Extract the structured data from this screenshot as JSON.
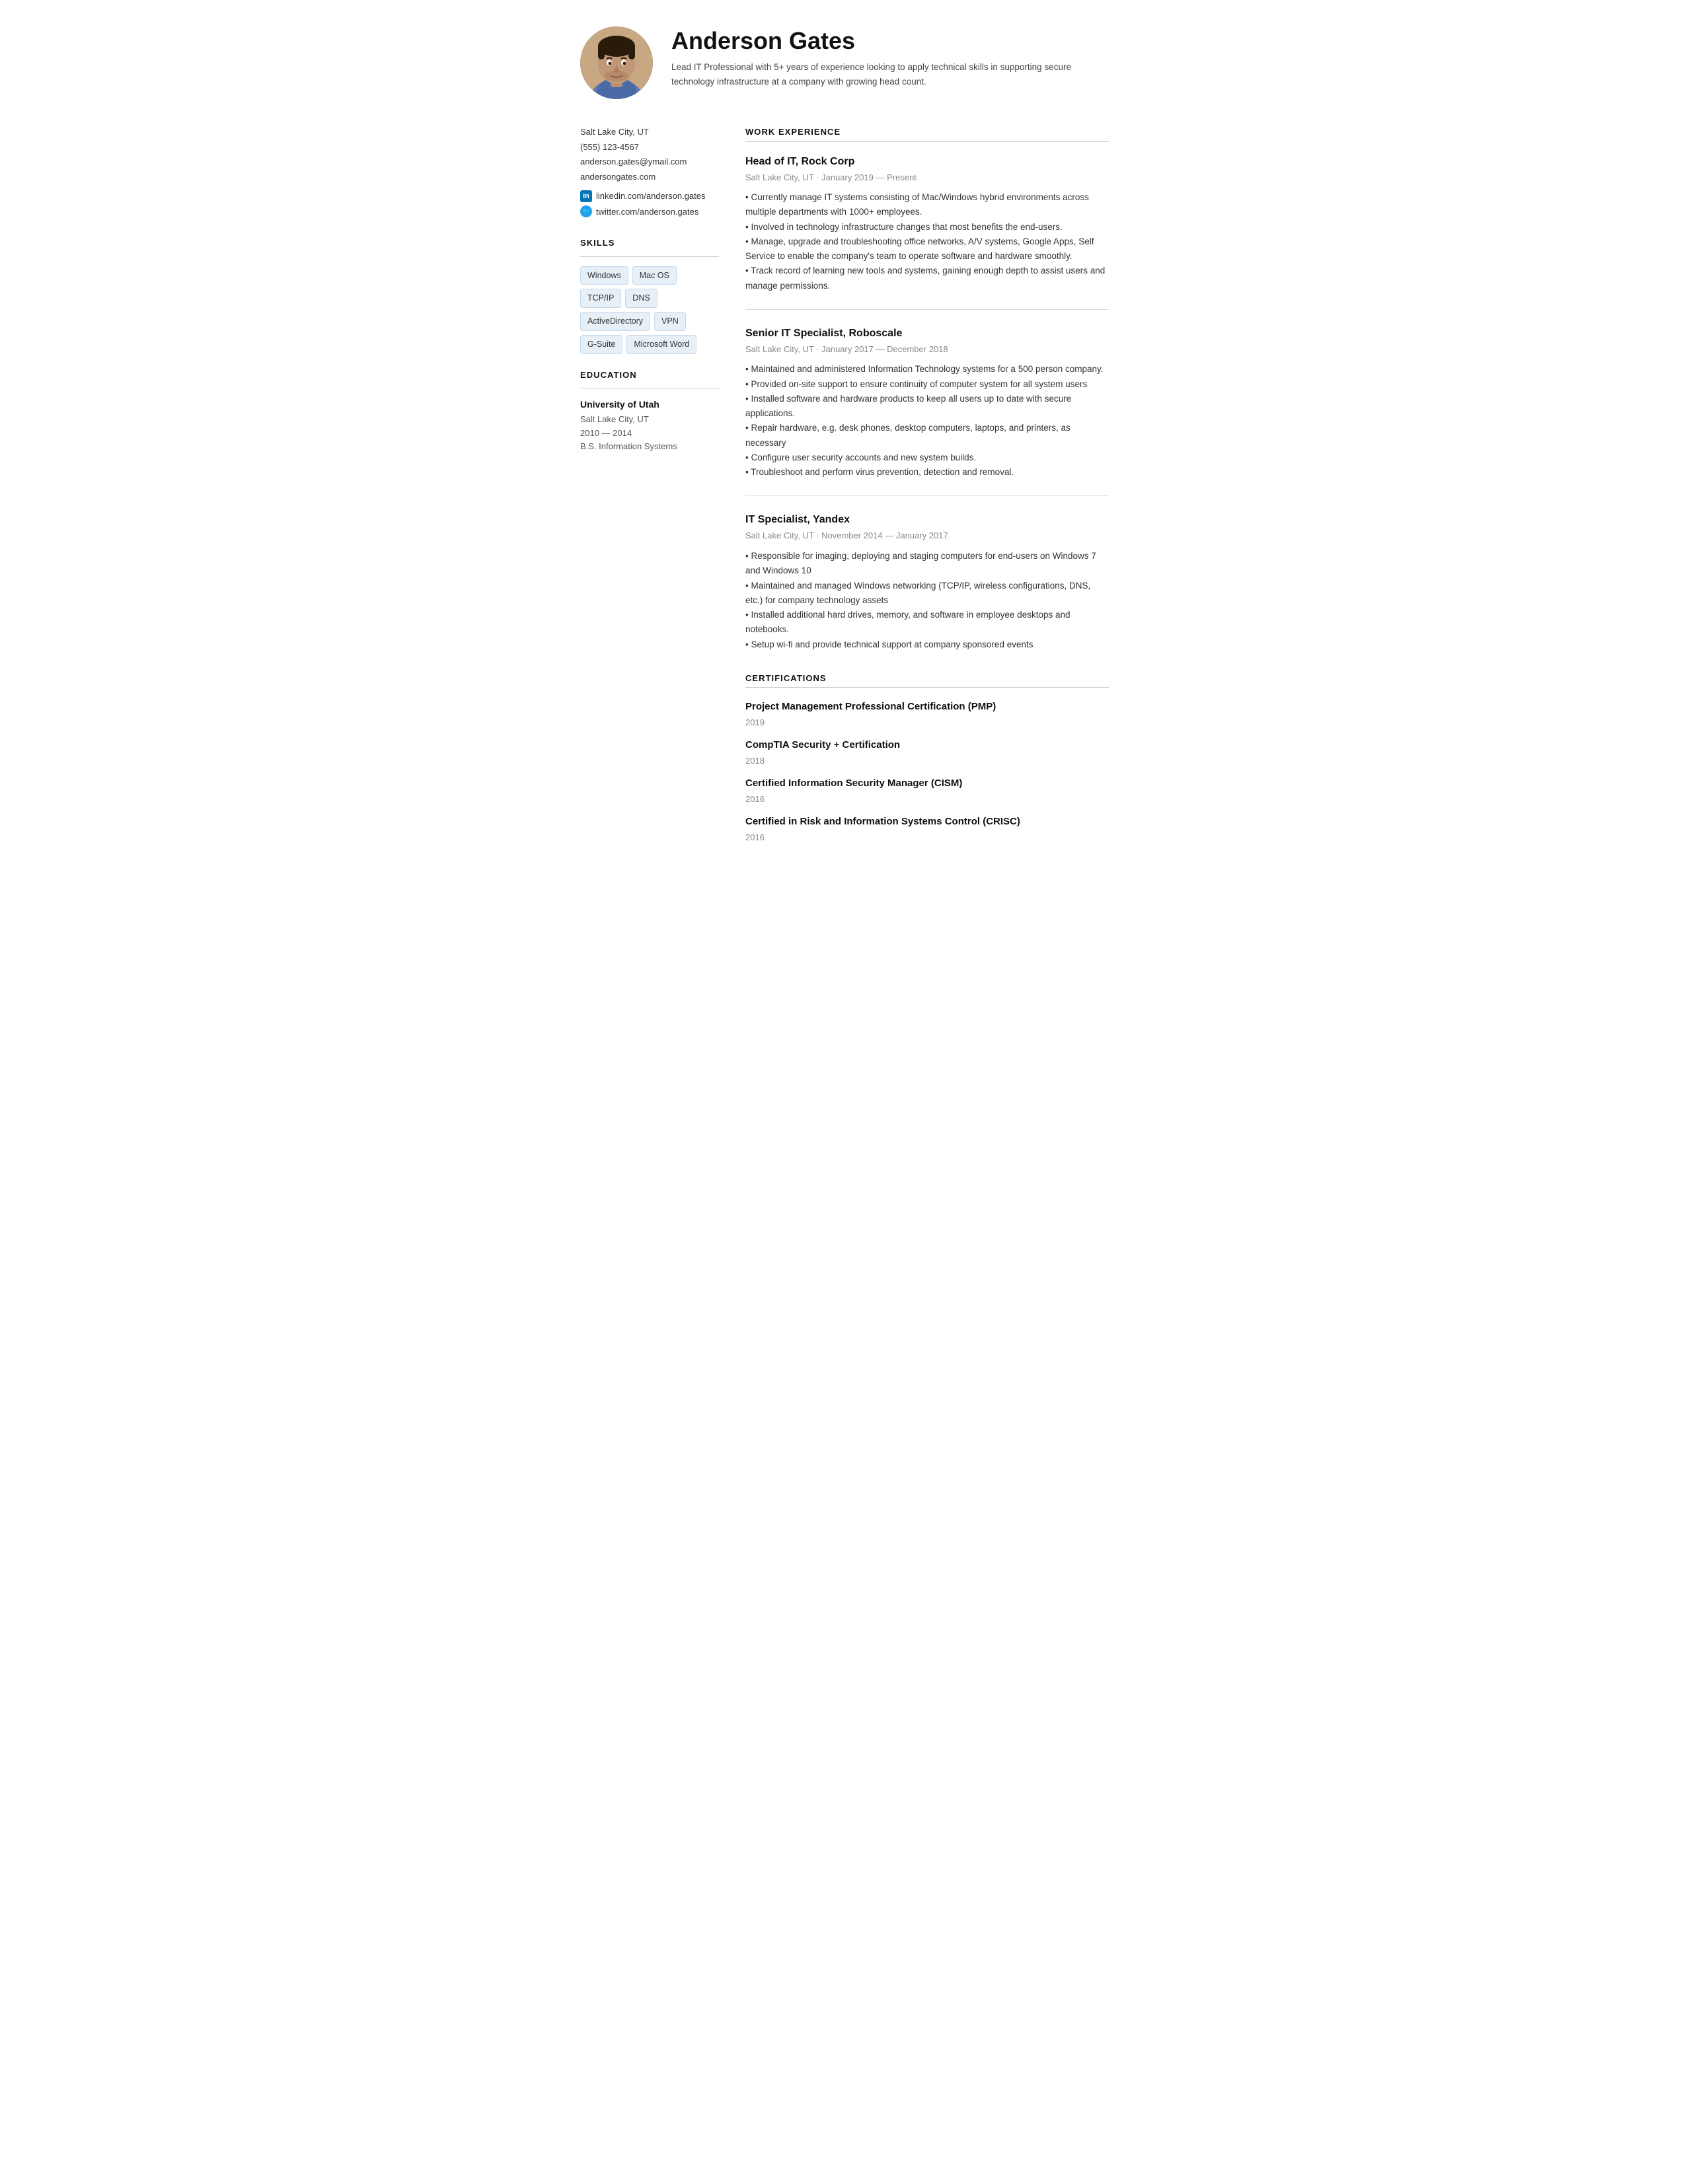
{
  "header": {
    "name": "Anderson Gates",
    "summary": "Lead IT Professional with 5+ years of experience looking to apply technical skills in supporting secure technology infrastructure at a company with growing head count."
  },
  "sidebar": {
    "contact": {
      "location": "Salt Lake City, UT",
      "phone": "(555) 123-4567",
      "email": "anderson.gates@ymail.com",
      "website": "andersongates.com"
    },
    "social": [
      {
        "platform": "linkedin",
        "label": "linkedin.com/anderson.gates",
        "icon": "in"
      },
      {
        "platform": "twitter",
        "label": "twitter.com/anderson.gates",
        "icon": "🐦"
      }
    ],
    "skills_title": "SKILLS",
    "skills": [
      "Windows",
      "Mac OS",
      "TCP/IP",
      "DNS",
      "ActiveDirectory",
      "VPN",
      "G-Suite",
      "Microsoft Word"
    ],
    "education_title": "EDUCATION",
    "education": [
      {
        "school": "University of Utah",
        "location": "Salt Lake City, UT",
        "dates": "2010 — 2014",
        "degree": "B.S. Information Systems"
      }
    ]
  },
  "main": {
    "work_title": "WORK EXPERIENCE",
    "jobs": [
      {
        "title": "Head of IT, Rock Corp",
        "meta": "Salt Lake City, UT · January 2019 — Present",
        "bullets": "• Currently manage IT systems consisting of Mac/Windows hybrid environments across multiple departments with 1000+ employees.\n• Involved in technology infrastructure changes that most benefits the end-users.\n• Manage, upgrade and troubleshooting office networks, A/V systems, Google Apps, Self Service to enable the company's team to operate software and hardware smoothly.\n• Track record of learning new tools and systems, gaining enough depth to assist users and manage permissions."
      },
      {
        "title": "Senior IT Specialist, Roboscale",
        "meta": "Salt Lake City, UT · January 2017 — December 2018",
        "bullets": "• Maintained and administered Information Technology systems for a 500 person company.\n• Provided on-site support to ensure continuity of computer system for all system users\n• Installed software and hardware products to keep all users up to date with secure applications.\n• Repair hardware, e.g. desk phones, desktop computers, laptops, and printers, as necessary\n• Configure user security accounts and new system builds.\n• Troubleshoot and perform virus prevention, detection and removal."
      },
      {
        "title": "IT Specialist, Yandex",
        "meta": "Salt Lake City, UT · November 2014 — January 2017",
        "bullets": "• Responsible for imaging, deploying and staging computers for end-users on Windows 7 and Windows 10\n• Maintained and managed Windows networking (TCP/IP, wireless configurations, DNS, etc.) for company technology assets\n• Installed additional hard drives, memory, and software in employee desktops and notebooks.\n• Setup wi-fi and provide technical support at company sponsored events"
      }
    ],
    "cert_title": "CERTIFICATIONS",
    "certifications": [
      {
        "name": "Project Management Professional Certification (PMP)",
        "year": "2019"
      },
      {
        "name": "CompTIA Security + Certification",
        "year": "2018"
      },
      {
        "name": "Certified Information Security Manager (CISM)",
        "year": "2016"
      },
      {
        "name": "Certified in Risk and Information Systems Control (CRISC)",
        "year": "2016"
      }
    ]
  }
}
